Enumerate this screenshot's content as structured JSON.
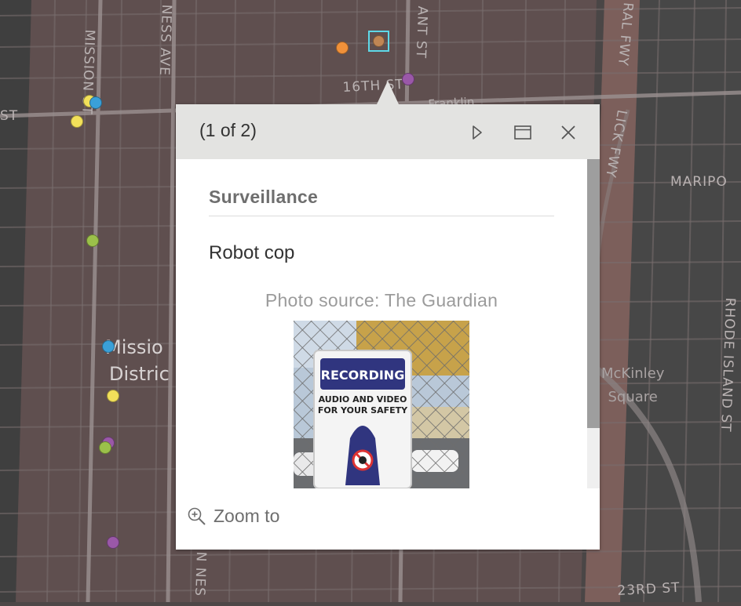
{
  "map": {
    "street_labels": {
      "ness_ave": "NESS AVE",
      "mission_st": "MISSION ST",
      "st_left": "ST",
      "bryant_st": "ANT ST",
      "sixteenth": "16TH ST",
      "franklin": "Franklin",
      "central_fwy": "RAL FWY",
      "kinley_fwy": "LICK FWY",
      "mariposa": "MARIPO",
      "rhode_island": "RHODE ISLAND ST",
      "twentythird": "23RD ST",
      "van_ness_bottom": "N NES"
    },
    "area_labels": {
      "mission_district_line1": "Missio",
      "mission_district_line2": "Distric",
      "mckinley_line1": "McKinley",
      "mckinley_line2": "Square"
    },
    "marker_colors": {
      "yellow": "#f2e05a",
      "blue": "#3aa0d8",
      "green": "#9bc04a",
      "purple": "#9a58a8",
      "orange": "#f0913a",
      "brown": "#c08654",
      "selection": "#5ed8e8"
    }
  },
  "popup": {
    "counter": "(1 of 2)",
    "title": "Surveillance",
    "description": "Robot cop",
    "photo_caption": "Photo source: The Guardian",
    "photo": {
      "sign_title": "RECORDING",
      "sign_line1": "AUDIO AND VIDEO",
      "sign_line2": "FOR YOUR SAFETY"
    },
    "zoom_label": "Zoom to",
    "icons": {
      "next": "play-triangle-icon",
      "dock": "dock-window-icon",
      "close": "close-x-icon",
      "zoom": "zoom-in-magnifier-icon"
    }
  }
}
